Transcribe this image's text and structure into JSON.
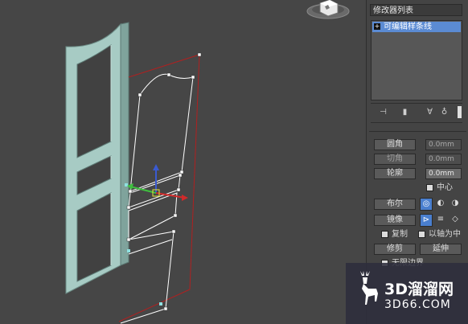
{
  "panel": {
    "title": "修改器列表",
    "stack_items": [
      {
        "label": "可编辑样条线"
      }
    ]
  },
  "geometry": {
    "fillet_btn": "圆角",
    "fillet_value": "0.0mm",
    "chamfer_btn": "切角",
    "chamfer_value": "0.0mm",
    "outline_btn": "轮廓",
    "outline_value": "0.0mm",
    "center_label": "中心",
    "boolean_btn": "布尔",
    "mirror_btn": "镜像",
    "copy_label": "复制",
    "about_pivot_label": "以轴为中",
    "trim_btn": "修剪",
    "extend_btn": "延伸",
    "infinite_bounds_label": "无限边界"
  },
  "watermark": {
    "title": "3D溜溜网",
    "subtitle": "3D66.COM"
  },
  "colors": {
    "door_fill": "#a3c7c0",
    "selection_highlight": "#5b8bd3",
    "spline_line": "#ffffff",
    "bounding_box": "#b02020"
  },
  "icons": {
    "pin": "pin-icon",
    "show_result": "show-result-icon",
    "make_unique": "make-unique-icon",
    "remove_modifier": "remove-modifier-icon",
    "configure": "configure-icon"
  }
}
